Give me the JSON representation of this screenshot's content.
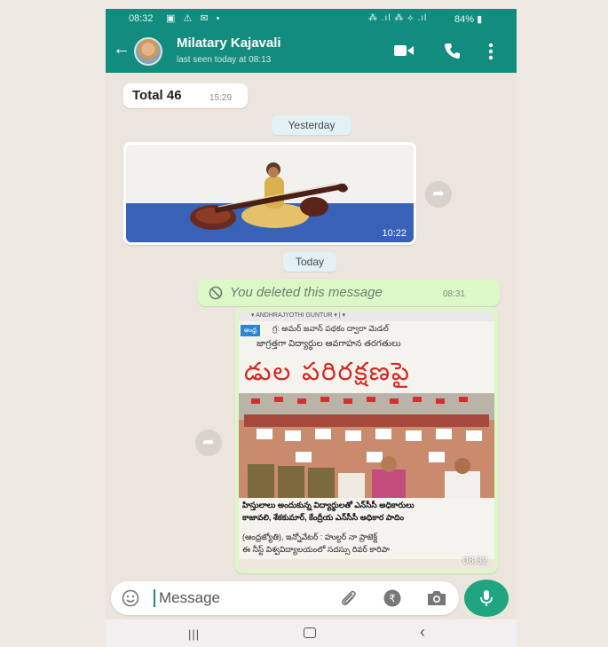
{
  "status_bar": {
    "time": "08:32",
    "left_icons": "▣ ⚠ ✉ •",
    "right_icons": "⁂ .ıl ⁂ ⟡ .ıl",
    "battery": "84%"
  },
  "header": {
    "contact_name": "Milatary Kajavali",
    "last_seen": "last seen today at 08:13"
  },
  "messages": {
    "total": {
      "text": "Total 46",
      "time": "15:29"
    },
    "date_yesterday": "Yesterday",
    "image": {
      "time": "10:22"
    },
    "date_today": "Today",
    "deleted": {
      "text": "You deleted this message",
      "time": "08:31"
    },
    "news": {
      "time": "08:32",
      "topbar": "▾   ANDHRAJYOTHI GUNTUR ▾  |  ▾",
      "kicker_tag": "ఆంధ్ర",
      "kicker": "గ్ర: అమర్ జవాన్ పథకం ద్వారా మెడల్",
      "sub": "జాగ్రత్తగా విద్యార్థుల ఆవగాహన తరగతులు",
      "headline": "డుల పరిరక్షణపై",
      "caption1": "హిస్తులాలు అందుకున్న విద్యార్థులతో ఎన్‌సీసీ అధికారులు",
      "caption2": "కాజావలి, శేకకుమార్, కేంద్రీయ ఎన్‌సీసీ అధికార పాదిం",
      "body1": "(ఆంధ్రజ్యోతి), ఇన్నోవేటర్ : హుల్దర్ నా ప్రాజెక్ట్",
      "body2": "ఈ నీస్ట్ విశ్వవిద్యాలయంలో సదస్సు రివర్ కారిపా"
    }
  },
  "input": {
    "placeholder": "Message"
  },
  "colors": {
    "header": "#128c7e",
    "outgoing_bubble": "#dcf8c6",
    "mic_button": "#1fa57f",
    "chat_bg": "#ece5dd"
  },
  "icons": [
    "back-arrow-icon",
    "avatar",
    "video-call-icon",
    "voice-call-icon",
    "menu-icon",
    "forward-icon",
    "block-icon",
    "emoji-icon",
    "attach-icon",
    "rupee-payment-icon",
    "camera-icon",
    "mic-icon"
  ]
}
